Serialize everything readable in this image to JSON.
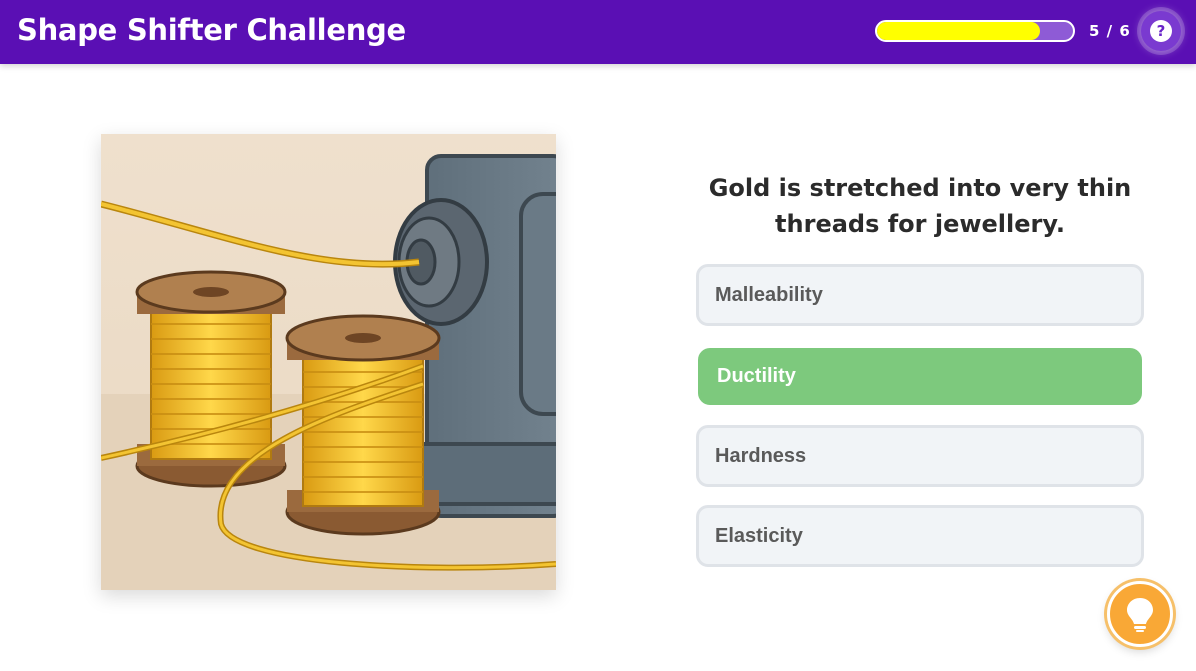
{
  "header": {
    "title": "Shape Shifter Challenge",
    "progress": {
      "current": 5,
      "total": 6,
      "fraction": 0.83,
      "label": "5 / 6"
    },
    "help_icon": "help-icon",
    "colors": {
      "bar": "#5a0fb4",
      "progress_fill": "#ffff00",
      "progress_track": "#8e5bd6"
    }
  },
  "main": {
    "illustration_icon": "gold-thread-spools-illustration",
    "question": "Gold is stretched into very thin threads for jewellery.",
    "options": [
      {
        "label": "Malleability",
        "selected": false
      },
      {
        "label": "Ductility",
        "selected": true
      },
      {
        "label": "Hardness",
        "selected": false
      },
      {
        "label": "Elasticity",
        "selected": false
      }
    ],
    "colors": {
      "selected": "#7dc97d",
      "option_bg": "#f1f4f7"
    }
  },
  "hint": {
    "icon": "lightbulb-icon",
    "color": "#f9a836"
  }
}
